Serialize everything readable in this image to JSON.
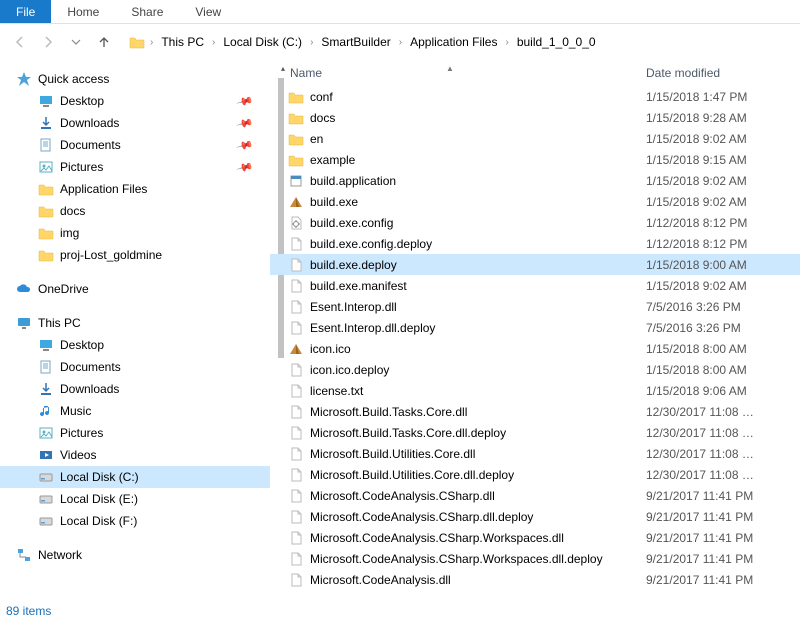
{
  "ribbon": {
    "file": "File",
    "tabs": [
      "Home",
      "Share",
      "View"
    ]
  },
  "breadcrumb": [
    "This PC",
    "Local Disk (C:)",
    "SmartBuilder",
    "Application Files",
    "build_1_0_0_0"
  ],
  "sidebar": {
    "quick_access": {
      "label": "Quick access",
      "items": [
        {
          "label": "Desktop",
          "icon": "desktop",
          "pinned": true
        },
        {
          "label": "Downloads",
          "icon": "downloads",
          "pinned": true
        },
        {
          "label": "Documents",
          "icon": "documents",
          "pinned": true
        },
        {
          "label": "Pictures",
          "icon": "pictures",
          "pinned": true
        },
        {
          "label": "Application Files",
          "icon": "folder"
        },
        {
          "label": "docs",
          "icon": "folder"
        },
        {
          "label": "img",
          "icon": "folder"
        },
        {
          "label": "proj-Lost_goldmine",
          "icon": "folder"
        }
      ]
    },
    "onedrive": {
      "label": "OneDrive"
    },
    "this_pc": {
      "label": "This PC",
      "items": [
        {
          "label": "Desktop",
          "icon": "desktop"
        },
        {
          "label": "Documents",
          "icon": "documents"
        },
        {
          "label": "Downloads",
          "icon": "downloads"
        },
        {
          "label": "Music",
          "icon": "music"
        },
        {
          "label": "Pictures",
          "icon": "pictures"
        },
        {
          "label": "Videos",
          "icon": "videos"
        },
        {
          "label": "Local Disk (C:)",
          "icon": "disk",
          "selected": true
        },
        {
          "label": "Local Disk (E:)",
          "icon": "disk"
        },
        {
          "label": "Local Disk (F:)",
          "icon": "disk"
        }
      ]
    },
    "network": {
      "label": "Network"
    }
  },
  "columns": {
    "name": "Name",
    "date": "Date modified"
  },
  "files": [
    {
      "name": "conf",
      "date": "1/15/2018 1:47 PM",
      "icon": "folder"
    },
    {
      "name": "docs",
      "date": "1/15/2018 9:28 AM",
      "icon": "folder"
    },
    {
      "name": "en",
      "date": "1/15/2018 9:02 AM",
      "icon": "folder"
    },
    {
      "name": "example",
      "date": "1/15/2018 9:15 AM",
      "icon": "folder"
    },
    {
      "name": "build.application",
      "date": "1/15/2018 9:02 AM",
      "icon": "app"
    },
    {
      "name": "build.exe",
      "date": "1/15/2018 9:02 AM",
      "icon": "pyramid"
    },
    {
      "name": "build.exe.config",
      "date": "1/12/2018 8:12 PM",
      "icon": "config"
    },
    {
      "name": "build.exe.config.deploy",
      "date": "1/12/2018 8:12 PM",
      "icon": "file"
    },
    {
      "name": "build.exe.deploy",
      "date": "1/15/2018 9:00 AM",
      "icon": "file",
      "selected": true
    },
    {
      "name": "build.exe.manifest",
      "date": "1/15/2018 9:02 AM",
      "icon": "file"
    },
    {
      "name": "Esent.Interop.dll",
      "date": "7/5/2016 3:26 PM",
      "icon": "file"
    },
    {
      "name": "Esent.Interop.dll.deploy",
      "date": "7/5/2016 3:26 PM",
      "icon": "file"
    },
    {
      "name": "icon.ico",
      "date": "1/15/2018 8:00 AM",
      "icon": "pyramid"
    },
    {
      "name": "icon.ico.deploy",
      "date": "1/15/2018 8:00 AM",
      "icon": "file"
    },
    {
      "name": "license.txt",
      "date": "1/15/2018 9:06 AM",
      "icon": "file"
    },
    {
      "name": "Microsoft.Build.Tasks.Core.dll",
      "date": "12/30/2017 11:08 …",
      "icon": "file"
    },
    {
      "name": "Microsoft.Build.Tasks.Core.dll.deploy",
      "date": "12/30/2017 11:08 …",
      "icon": "file"
    },
    {
      "name": "Microsoft.Build.Utilities.Core.dll",
      "date": "12/30/2017 11:08 …",
      "icon": "file"
    },
    {
      "name": "Microsoft.Build.Utilities.Core.dll.deploy",
      "date": "12/30/2017 11:08 …",
      "icon": "file"
    },
    {
      "name": "Microsoft.CodeAnalysis.CSharp.dll",
      "date": "9/21/2017 11:41 PM",
      "icon": "file"
    },
    {
      "name": "Microsoft.CodeAnalysis.CSharp.dll.deploy",
      "date": "9/21/2017 11:41 PM",
      "icon": "file"
    },
    {
      "name": "Microsoft.CodeAnalysis.CSharp.Workspaces.dll",
      "date": "9/21/2017 11:41 PM",
      "icon": "file"
    },
    {
      "name": "Microsoft.CodeAnalysis.CSharp.Workspaces.dll.deploy",
      "date": "9/21/2017 11:41 PM",
      "icon": "file"
    },
    {
      "name": "Microsoft.CodeAnalysis.dll",
      "date": "9/21/2017 11:41 PM",
      "icon": "file"
    }
  ],
  "status": {
    "items": "89 items"
  }
}
